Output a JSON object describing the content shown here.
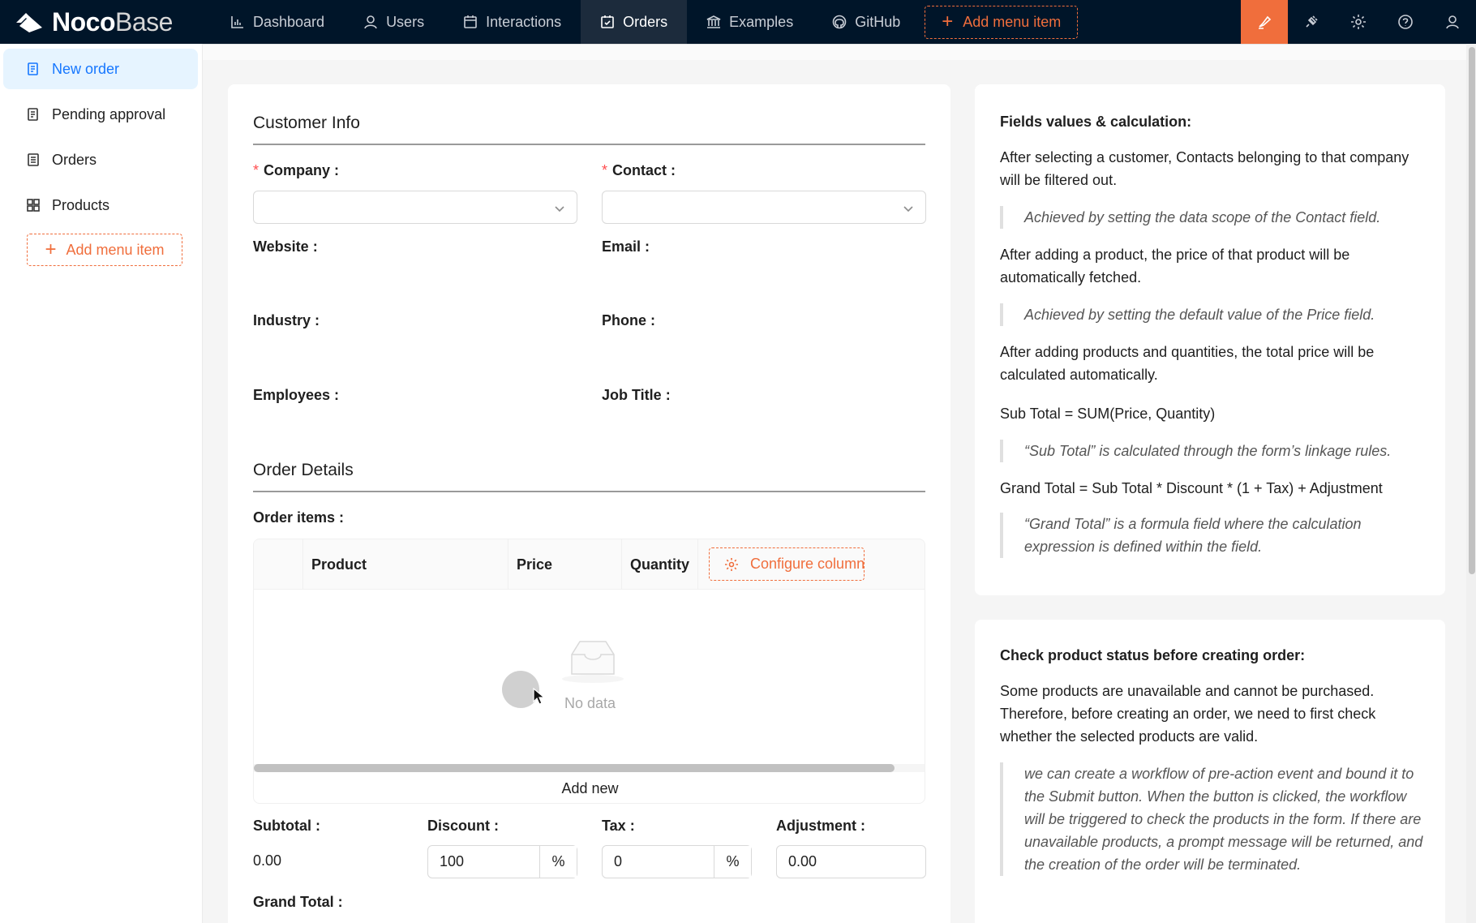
{
  "brand": {
    "name_bold": "Noco",
    "name_light": "Base"
  },
  "topnav": {
    "items": [
      {
        "label": "Dashboard",
        "icon": "bar-chart-icon"
      },
      {
        "label": "Users",
        "icon": "user-icon"
      },
      {
        "label": "Interactions",
        "icon": "calendar-icon"
      },
      {
        "label": "Orders",
        "icon": "check-calendar-icon"
      },
      {
        "label": "Examples",
        "icon": "bank-icon"
      },
      {
        "label": "GitHub",
        "icon": "github-icon"
      }
    ],
    "add_menu_label": "Add menu item",
    "accent": "#f06e3c"
  },
  "sidebar": {
    "items": [
      {
        "label": "New order",
        "icon": "form-icon"
      },
      {
        "label": "Pending approval",
        "icon": "form-icon"
      },
      {
        "label": "Orders",
        "icon": "table-icon"
      },
      {
        "label": "Products",
        "icon": "grid-icon"
      }
    ],
    "add_menu_label": "Add menu item"
  },
  "form": {
    "customer_title": "Customer Info",
    "company_label": "Company",
    "contact_label": "Contact",
    "website_label": "Website",
    "email_label": "Email",
    "industry_label": "Industry",
    "phone_label": "Phone",
    "employees_label": "Employees",
    "job_title_label": "Job Title",
    "order_title": "Order Details",
    "order_items_label": "Order items",
    "table": {
      "columns": [
        "Product",
        "Price",
        "Quantity"
      ],
      "configure_label": "Configure columns",
      "empty_text": "No data",
      "add_new_label": "Add new"
    },
    "subtotal_label": "Subtotal",
    "subtotal_value": "0.00",
    "discount_label": "Discount",
    "discount_value": "100",
    "discount_unit": "%",
    "tax_label": "Tax",
    "tax_value": "0",
    "tax_unit": "%",
    "adjustment_label": "Adjustment",
    "adjustment_value": "0.00",
    "grand_total_label": "Grand Total"
  },
  "info1": {
    "heading": "Fields values & calculation:",
    "p1": "After selecting a customer, Contacts belonging to that company will be filtered out.",
    "q1": "Achieved by setting the data scope of the Contact field.",
    "p2": "After adding a product, the price of that product will be automatically fetched.",
    "q2": "Achieved by setting the default value of the Price field.",
    "p3": "After adding products and quantities, the total price will be calculated automatically.",
    "p4": "Sub Total = SUM(Price, Quantity)",
    "q3": "“Sub Total” is calculated through the form’s linkage rules.",
    "p5": "Grand Total = Sub Total * Discount * (1 + Tax) + Adjustment",
    "q4": "“Grand Total” is a formula field where the calculation expression is defined within the field."
  },
  "info2": {
    "heading": "Check product status before creating order:",
    "p1": "Some products are unavailable and cannot be purchased. Therefore, before creating an order, we need to first check whether the selected products are valid.",
    "q1": "we can create a workflow of pre-action event and bound it to the Submit button. When the button is clicked, the workflow will be triggered to check the products in the form. If there are unavailable products, a prompt message will be returned, and the creation of the order will be terminated."
  }
}
